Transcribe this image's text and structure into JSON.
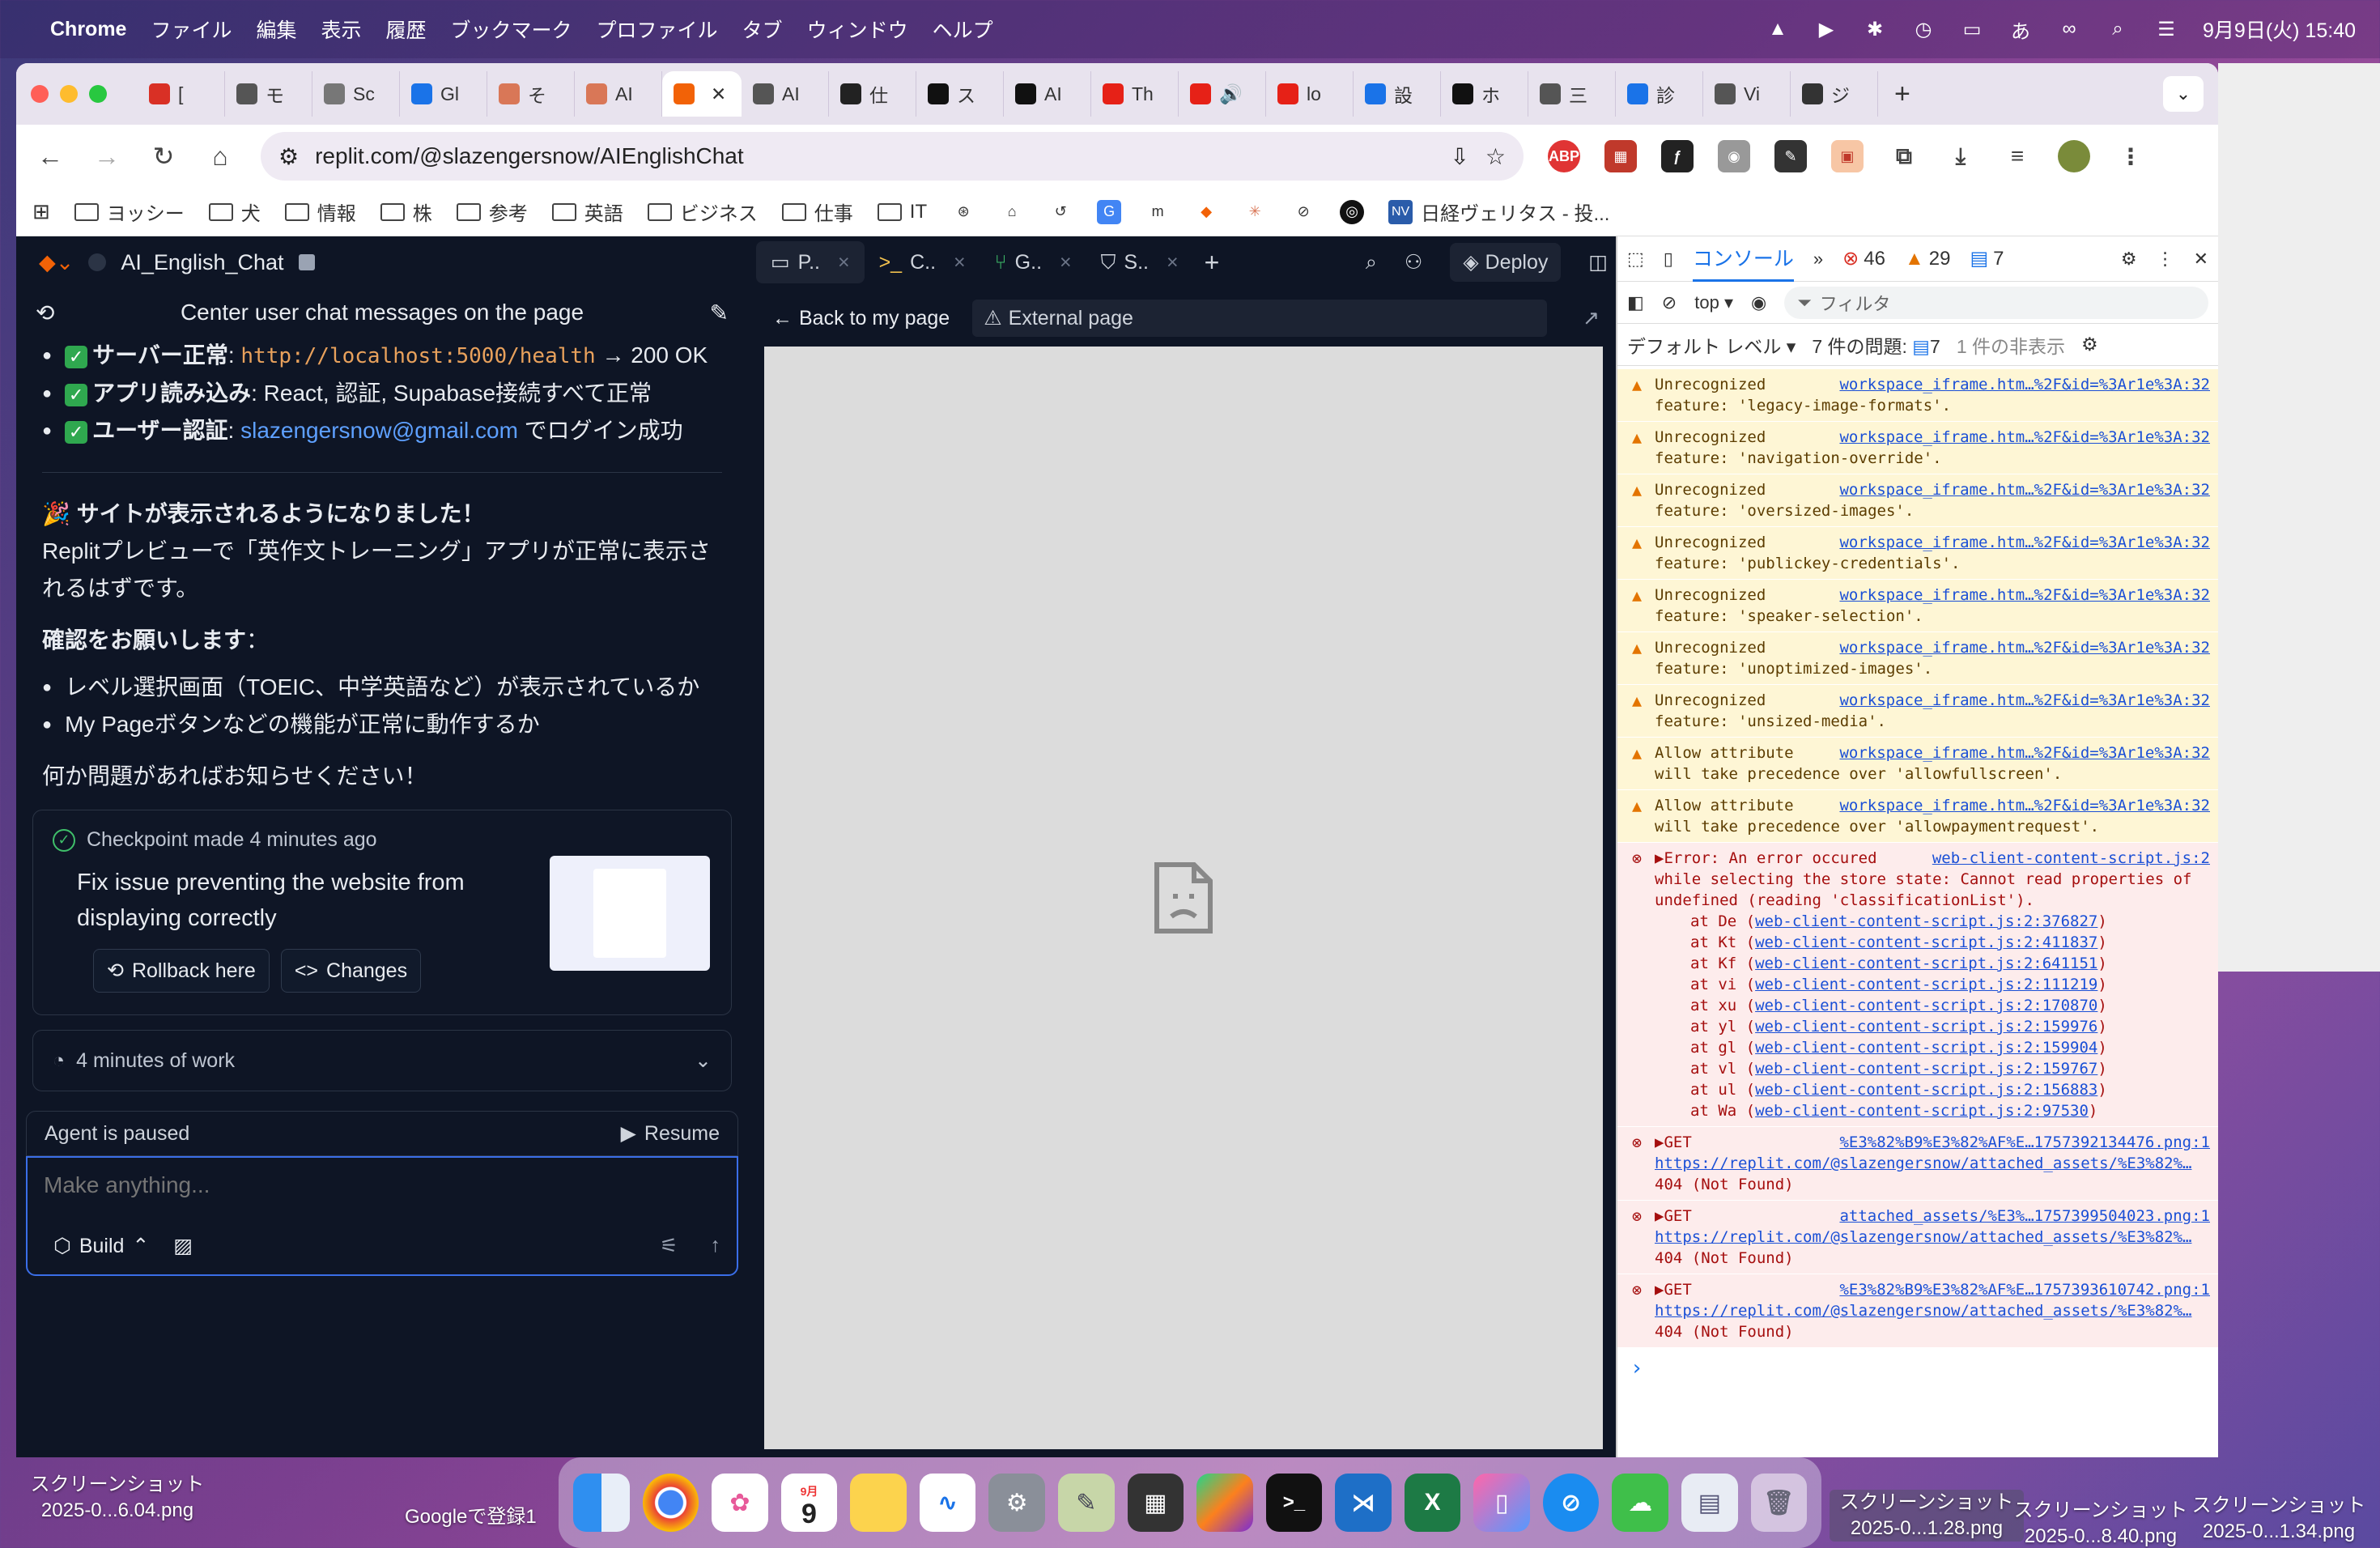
{
  "menubar": {
    "app": "Chrome",
    "items": [
      "ファイル",
      "編集",
      "表示",
      "履歴",
      "ブックマーク",
      "プロファイル",
      "タブ",
      "ウィンドウ",
      "ヘルプ"
    ],
    "input_method": "あ",
    "datetime": "9月9日(火) 15:40"
  },
  "tabs": [
    {
      "label": "[",
      "icon": "gmail-icon",
      "color": "#d93025"
    },
    {
      "label": "モ",
      "icon": "globe-icon",
      "color": "#555"
    },
    {
      "label": "Sc",
      "icon": "camera-icon",
      "color": "#777"
    },
    {
      "label": "Gl",
      "icon": "calendar-icon",
      "color": "#1a73e8"
    },
    {
      "label": "そ",
      "icon": "asterisk-icon",
      "color": "#d97757"
    },
    {
      "label": "AI",
      "icon": "asterisk-icon",
      "color": "#d97757"
    },
    {
      "label": "",
      "icon": "replit-icon",
      "color": "#f26207",
      "active": true
    },
    {
      "label": "AI",
      "icon": "globe-icon",
      "color": "#555"
    },
    {
      "label": "仕",
      "icon": "openai-icon",
      "color": "#222"
    },
    {
      "label": "ス",
      "icon": "notion-icon",
      "color": "#111"
    },
    {
      "label": "AI",
      "icon": "notion-icon",
      "color": "#111"
    },
    {
      "label": "Th",
      "icon": "youtube-icon",
      "color": "#e62117"
    },
    {
      "label": "🔊",
      "icon": "youtube-icon",
      "color": "#e62117"
    },
    {
      "label": "lo",
      "icon": "youtube-icon",
      "color": "#e62117"
    },
    {
      "label": "設",
      "icon": "gear-icon",
      "color": "#1a73e8"
    },
    {
      "label": "ホ",
      "icon": "x-icon",
      "color": "#111"
    },
    {
      "label": "三",
      "icon": "globe-icon",
      "color": "#555"
    },
    {
      "label": "診",
      "icon": "safari-icon",
      "color": "#1a73e8"
    },
    {
      "label": "Vi",
      "icon": "globe-icon",
      "color": "#555"
    },
    {
      "label": "ジ",
      "icon": "wikipedia-icon",
      "color": "#333"
    }
  ],
  "toolbar": {
    "url": "replit.com/@slazengersnow/AIEnglishChat"
  },
  "bookmarks": [
    {
      "label": "ヨッシー",
      "type": "folder"
    },
    {
      "label": "犬",
      "type": "folder"
    },
    {
      "label": "情報",
      "type": "folder"
    },
    {
      "label": "株",
      "type": "folder"
    },
    {
      "label": "参考",
      "type": "folder"
    },
    {
      "label": "英語",
      "type": "folder"
    },
    {
      "label": "ビジネス",
      "type": "folder"
    },
    {
      "label": "仕事",
      "type": "folder"
    },
    {
      "label": "IT",
      "type": "folder"
    },
    {
      "label": "日経ヴェリタス - 投...",
      "type": "site"
    }
  ],
  "replit": {
    "project": "AI_English_Chat",
    "chat_title": "Center user chat messages on the page",
    "status_items": [
      {
        "label": "サーバー正常",
        "sep": ": ",
        "code": "http://localhost:5000/health",
        "rest": " → 200 OK"
      },
      {
        "label": "アプリ読み込み",
        "sep": ": ",
        "rest": "React, 認証, Supabase接続すべて正常"
      },
      {
        "label": "ユーザー認証",
        "sep": ": ",
        "link": "slazengersnow@gmail.com",
        "rest": " でログイン成功"
      }
    ],
    "success_title": "🎉 サイトが表示されるようになりました！",
    "success_body": "Replitプレビューで「英作文トレーニング」アプリが正常に表示されるはずです。",
    "confirm_heading": "確認をお願いします",
    "confirm_colon": "：",
    "confirm_items": [
      "レベル選択画面（TOEIC、中学英語など）が表示されているか",
      "My Pageボタンなどの機能が正常に動作するか"
    ],
    "closing": "何か問題があればお知らせください！",
    "checkpoint": {
      "meta": "Checkpoint made 4 minutes ago",
      "title": "Fix issue preventing the website from displaying correctly",
      "rollback": "Rollback here",
      "changes": "Changes"
    },
    "work": "4 minutes of work",
    "agent_status": "Agent is paused",
    "resume": "Resume",
    "composer_placeholder": "Make anything...",
    "build": "Build"
  },
  "workspace": {
    "tabs": [
      {
        "label": "P..",
        "icon": "monitor-icon"
      },
      {
        "label": "C..",
        "icon": "terminal-icon"
      },
      {
        "label": "G..",
        "icon": "git-icon"
      },
      {
        "label": "S..",
        "icon": "shield-icon"
      }
    ],
    "deploy": "Deploy",
    "back": "Back to my page",
    "external": "External page"
  },
  "devtools": {
    "tab": "コンソール",
    "errors": "46",
    "warnings": "29",
    "infos": "7",
    "context": "top",
    "filter": "フィルタ",
    "level": "デフォルト レベル",
    "issues_label": "7 件の問題:",
    "issues_count": "7",
    "hidden": "1 件の非表示",
    "messages": [
      {
        "type": "warn",
        "text": "Unrecognized feature: 'legacy-image-formats'.",
        "src": "workspace_iframe.htm…%2F&id=%3Ar1e%3A:32"
      },
      {
        "type": "warn",
        "text": "Unrecognized feature: 'navigation-override'.",
        "src": "workspace_iframe.htm…%2F&id=%3Ar1e%3A:32"
      },
      {
        "type": "warn",
        "text": "Unrecognized feature: 'oversized-images'.",
        "src": "workspace_iframe.htm…%2F&id=%3Ar1e%3A:32"
      },
      {
        "type": "warn",
        "text": "Unrecognized feature: 'publickey-credentials'.",
        "src": "workspace_iframe.htm…%2F&id=%3Ar1e%3A:32"
      },
      {
        "type": "warn",
        "text": "Unrecognized feature: 'speaker-selection'.",
        "src": "workspace_iframe.htm…%2F&id=%3Ar1e%3A:32"
      },
      {
        "type": "warn",
        "text": "Unrecognized feature: 'unoptimized-images'.",
        "src": "workspace_iframe.htm…%2F&id=%3Ar1e%3A:32"
      },
      {
        "type": "warn",
        "text": "Unrecognized feature: 'unsized-media'.",
        "src": "workspace_iframe.htm…%2F&id=%3Ar1e%3A:32"
      },
      {
        "type": "warn",
        "text": "Allow attribute will take precedence over 'allowfullscreen'.",
        "src": "workspace_iframe.htm…%2F&id=%3Ar1e%3A:32"
      },
      {
        "type": "warn",
        "text": "Allow attribute will take precedence over 'allowpaymentrequest'.",
        "src": "workspace_iframe.htm…%2F&id=%3Ar1e%3A:32"
      }
    ],
    "error_main": "▶Error: An error occured while selecting the store state: Cannot read properties of undefined (reading 'classificationList').",
    "error_src": "web-client-content-script.js:2",
    "stack": [
      {
        "fn": "at De",
        "loc": "web-client-content-script.js:2:376827"
      },
      {
        "fn": "at Kt",
        "loc": "web-client-content-script.js:2:411837"
      },
      {
        "fn": "at Kf",
        "loc": "web-client-content-script.js:2:641151"
      },
      {
        "fn": "at vi",
        "loc": "web-client-content-script.js:2:111219"
      },
      {
        "fn": "at xu",
        "loc": "web-client-content-script.js:2:170870"
      },
      {
        "fn": "at yl",
        "loc": "web-client-content-script.js:2:159976"
      },
      {
        "fn": "at gl",
        "loc": "web-client-content-script.js:2:159904"
      },
      {
        "fn": "at vl",
        "loc": "web-client-content-script.js:2:159767"
      },
      {
        "fn": "at ul",
        "loc": "web-client-content-script.js:2:156883"
      },
      {
        "fn": "at Wa",
        "loc": "web-client-content-script.js:2:97530"
      }
    ],
    "gets": [
      {
        "src": "%E3%82%B9%E3%82%AF%E…1757392134476.png:1",
        "url": "https://replit.com/@slazengersnow/attached_assets/%E3%82%…",
        "status": "404 (Not Found)"
      },
      {
        "src": "attached_assets/%E3%…1757399504023.png:1",
        "url": "https://replit.com/@slazengersnow/attached_assets/%E3%82%…",
        "status": "404 (Not Found)"
      },
      {
        "src": "%E3%82%B9%E3%82%AF%E…1757393610742.png:1",
        "url": "https://replit.com/@slazengersnow/attached_assets/%E3%82%…",
        "status": "404 (Not Found)"
      }
    ],
    "get_label": "▶GET"
  },
  "desktop": {
    "left_file": "スクリーンショット\n2025-0...6.04.png",
    "google_file": "Googleで登録1",
    "file2": "スクリーンショット\n2025-0...1.28.png",
    "file3": "スクリーンショット\n2025-0...8.40.png",
    "file4": "スクリーンショット\n2025-0...1.34.png"
  },
  "dock": [
    "finder",
    "chrome",
    "photos",
    "calendar",
    "notes",
    "freeform",
    "settings",
    "scripteditor",
    "calculator",
    "pycharm",
    "terminal",
    "vscode",
    "excel",
    "ios",
    "safari",
    "cloud",
    "preview",
    "trash"
  ],
  "calendar_day": "9",
  "calendar_month": "9月"
}
